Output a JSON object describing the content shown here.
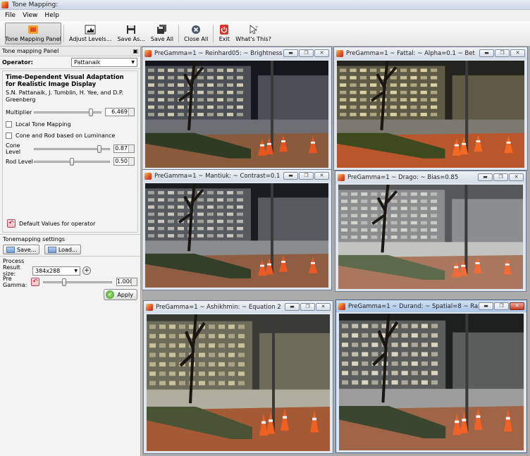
{
  "window": {
    "title": "Tone Mapping:"
  },
  "menu": {
    "items": [
      "File",
      "View",
      "Help"
    ]
  },
  "toolbar": {
    "buttons": [
      {
        "label": "Tone Mapping Panel",
        "icon": "tone-mapping-icon"
      },
      {
        "label": "Adjust Levels...",
        "icon": "levels-icon"
      },
      {
        "label": "Save As...",
        "icon": "floppy-disk-icon"
      },
      {
        "label": "Save All",
        "icon": "save-all-icon"
      },
      {
        "label": "Close All",
        "icon": "close-all-icon"
      },
      {
        "label": "Exit",
        "icon": "power-icon"
      },
      {
        "label": "What's This?",
        "icon": "whats-this-icon"
      }
    ]
  },
  "panel": {
    "title": "Tone mapping Panel",
    "operator_label": "Operator:",
    "operator_value": "Pattanaik",
    "op_title": "Time-Dependent Visual Adaptation for Realistic Image Display",
    "op_authors": "S.N. Pattanaik, J. Tumblin, H. Yee, and D.P. Greenberg",
    "multiplier": {
      "label": "Multiplier",
      "value": "6.469",
      "position": 0.85
    },
    "local_tone_mapping": "Local Tone Mapping",
    "cone_rod_luminance": "Cone and Rod based on Luminance",
    "cone_level": {
      "label": "Cone Level",
      "value": "0.87",
      "position": 0.87
    },
    "rod_level": {
      "label": "Rod Level",
      "value": "0.50",
      "position": 0.5
    },
    "default_values": "Default Values for operator",
    "settings_title": "Tonemapping settings",
    "save_btn": "Save...",
    "load_btn": "Load...",
    "process_title": "Process",
    "result_size_label": "Result size:",
    "result_size_value": "384x288",
    "pregamma_label": "Pre Gamma:",
    "pregamma_value": "1.000",
    "pregamma_position": 0.3,
    "apply_btn": "Apply"
  },
  "windows": [
    {
      "title": "PreGamma=1 ~ Reinhard05: ~ Brightness",
      "tone": "reinhard"
    },
    {
      "title": "PreGamma=1 ~ Fattal: ~ Alpha=0.1 ~ Bet",
      "tone": "fattal"
    },
    {
      "title": "PreGamma=1 ~ Mantiuk: ~ Contrast=0.1",
      "tone": "mantiuk"
    },
    {
      "title": "PreGamma=1 ~ Drago: ~ Bias=0.85",
      "tone": "drago"
    },
    {
      "title": "PreGamma=1 ~ Ashikhmin: ~ Equation 2",
      "tone": "ashikhmin"
    },
    {
      "title": "PreGamma=1 ~ Durand: ~ Spatial=8 ~ Ra",
      "tone": "durand"
    }
  ],
  "colors": {
    "titlebar": "#d4dce7",
    "panel_bg": "#f3f3f3",
    "mdi_bg": "#ababab"
  }
}
